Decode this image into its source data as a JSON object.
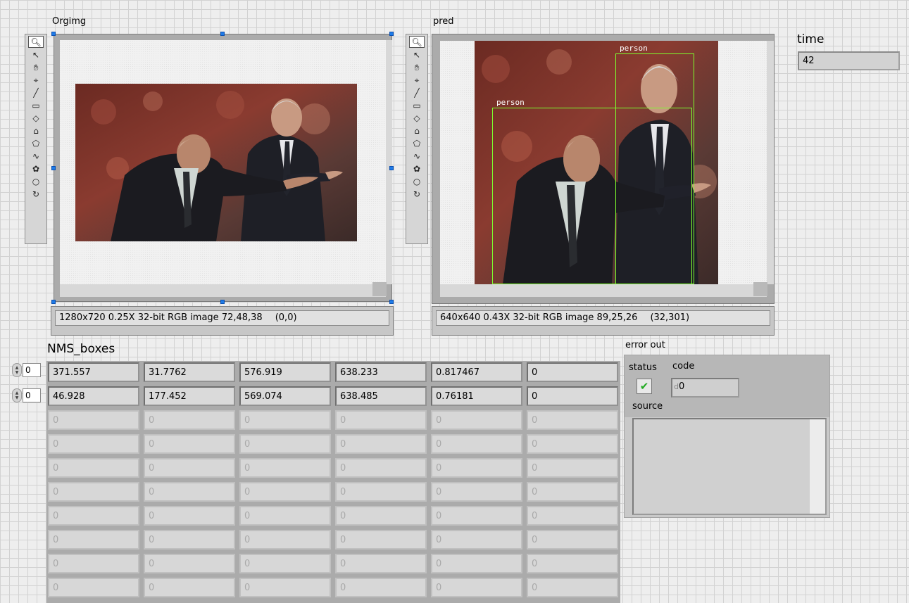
{
  "orgimg": {
    "label": "Orgimg",
    "info": "1280x720 0.25X 32-bit RGB image 72,48,38",
    "coord": "(0,0)"
  },
  "pred": {
    "label": "pred",
    "info": "640x640 0.43X 32-bit RGB image 89,25,26",
    "coord": "(32,301)",
    "detections": [
      {
        "label": "person"
      },
      {
        "label": "person"
      }
    ]
  },
  "toolbar": {
    "tools": [
      "zoom-icon",
      "pointer-icon",
      "pan-hand-icon",
      "point-crosshair-icon",
      "line-icon",
      "rectangle-icon",
      "rotated-rectangle-icon",
      "annulus-icon",
      "polygon-icon",
      "freehand-icon",
      "freehand-region-icon",
      "oval-icon",
      "annulus-arc-icon"
    ]
  },
  "time": {
    "label": "time",
    "value": "42"
  },
  "nms_boxes": {
    "label": "NMS_boxes",
    "row_index": "0",
    "col_index": "0",
    "rows": [
      [
        "371.557",
        "31.7762",
        "576.919",
        "638.233",
        "0.817467",
        "0"
      ],
      [
        "46.928",
        "177.452",
        "569.074",
        "638.485",
        "0.76181",
        "0"
      ],
      [
        "0",
        "0",
        "0",
        "0",
        "0",
        "0"
      ],
      [
        "0",
        "0",
        "0",
        "0",
        "0",
        "0"
      ],
      [
        "0",
        "0",
        "0",
        "0",
        "0",
        "0"
      ],
      [
        "0",
        "0",
        "0",
        "0",
        "0",
        "0"
      ],
      [
        "0",
        "0",
        "0",
        "0",
        "0",
        "0"
      ],
      [
        "0",
        "0",
        "0",
        "0",
        "0",
        "0"
      ],
      [
        "0",
        "0",
        "0",
        "0",
        "0",
        "0"
      ],
      [
        "0",
        "0",
        "0",
        "0",
        "0",
        "0"
      ]
    ]
  },
  "error_out": {
    "label": "error out",
    "status_label": "status",
    "code_label": "code",
    "source_label": "source",
    "code_radix": "d",
    "code_value": "0",
    "status_ok": true,
    "status_color": "#22aa22"
  }
}
